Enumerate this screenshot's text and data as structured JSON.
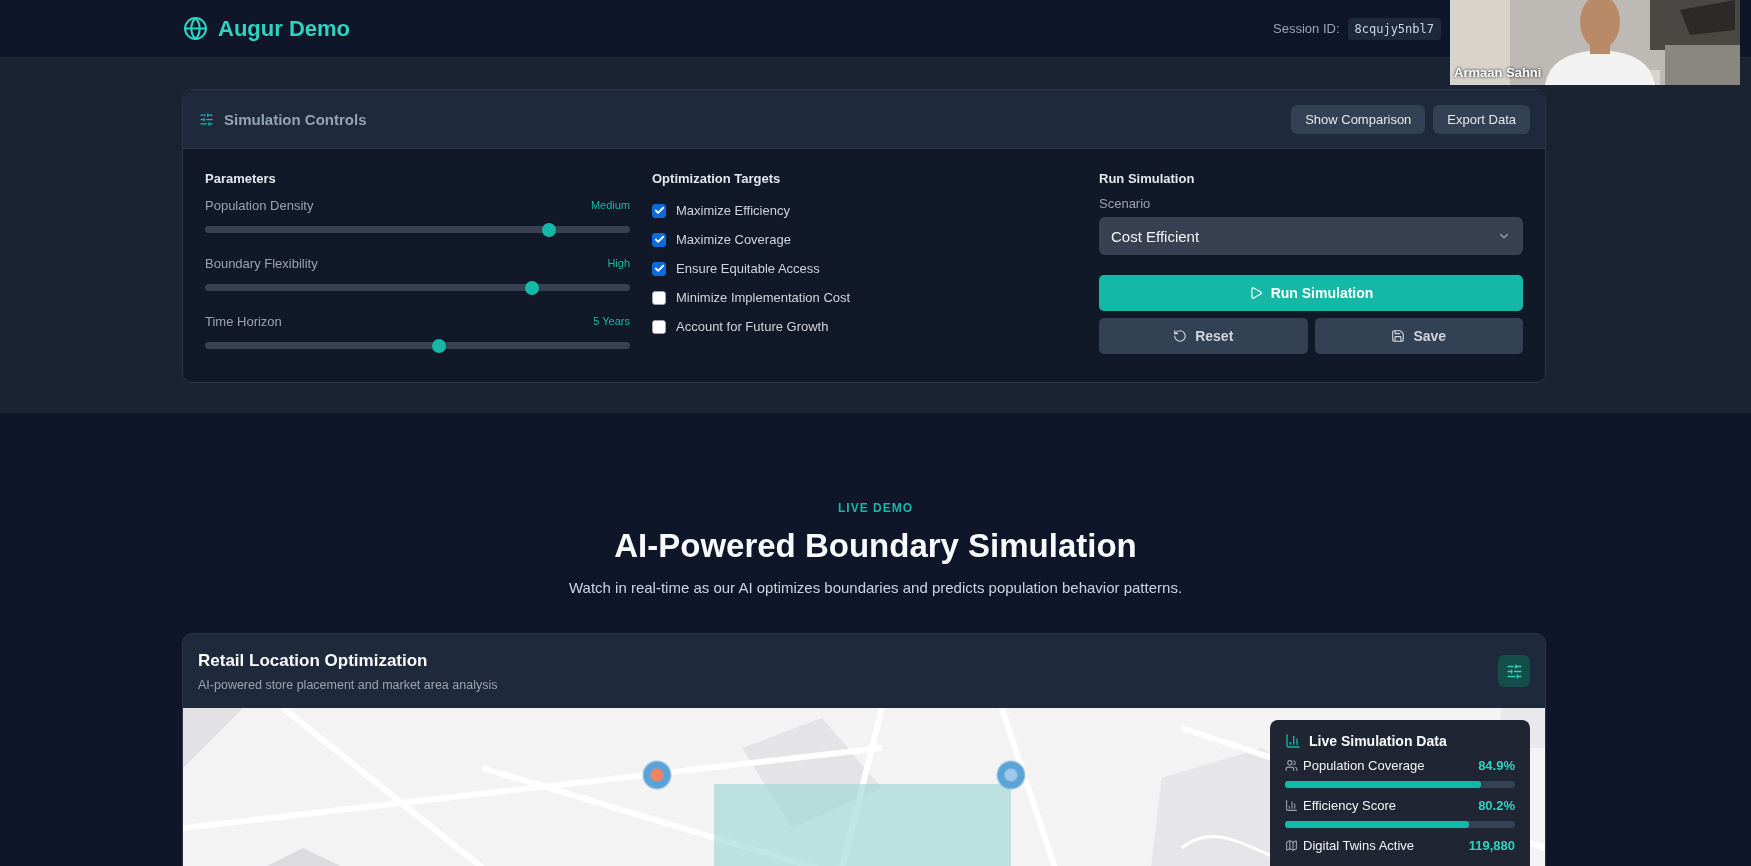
{
  "header": {
    "logo_text": "Augur Demo",
    "session_label": "Session ID:",
    "session_id": "8cqujy5nbl7"
  },
  "video_call": {
    "participant_name": "Armaan Sahni"
  },
  "controls": {
    "title": "Simulation Controls",
    "buttons": [
      "Show Comparison",
      "Export Data"
    ],
    "parameters": {
      "heading": "Parameters",
      "sliders": [
        {
          "label": "Population Density",
          "reading": "Medium",
          "level": 0.81
        },
        {
          "label": "Boundary Flexibility",
          "reading": "High",
          "level": 0.77
        },
        {
          "label": "Time Horizon",
          "reading": "5 Years",
          "level": 0.55
        }
      ]
    },
    "targets": {
      "heading": "Optimization Targets",
      "items": [
        {
          "label": "Maximize Efficiency",
          "checked": true
        },
        {
          "label": "Maximize Coverage",
          "checked": true
        },
        {
          "label": "Ensure Equitable Access",
          "checked": true
        },
        {
          "label": "Minimize Implementation Cost",
          "checked": false
        },
        {
          "label": "Account for Future Growth",
          "checked": false
        }
      ]
    },
    "run": {
      "heading": "Run Simulation",
      "scenario_label": "Scenario",
      "scenario_value": "Cost Efficient",
      "run_button": "Run Simulation",
      "reset_button": "Reset",
      "save_button": "Save"
    }
  },
  "demo": {
    "eyebrow": "LIVE DEMO",
    "title": "AI-Powered Boundary Simulation",
    "subtitle": "Watch in real-time as our AI optimizes boundaries and predicts population behavior patterns."
  },
  "card": {
    "title": "Retail Location Optimization",
    "subtitle": "AI-powered store placement and market area analysis",
    "live_data": {
      "title": "Live Simulation Data",
      "metrics": [
        {
          "kind": "bar",
          "label": "Population Coverage",
          "reading": "84.9%",
          "level": 0.85
        },
        {
          "kind": "bar",
          "label": "Efficiency Score",
          "reading": "80.2%",
          "level": 0.8
        },
        {
          "kind": "count",
          "label": "Digital Twins Active",
          "reading": "119,880"
        }
      ]
    }
  }
}
